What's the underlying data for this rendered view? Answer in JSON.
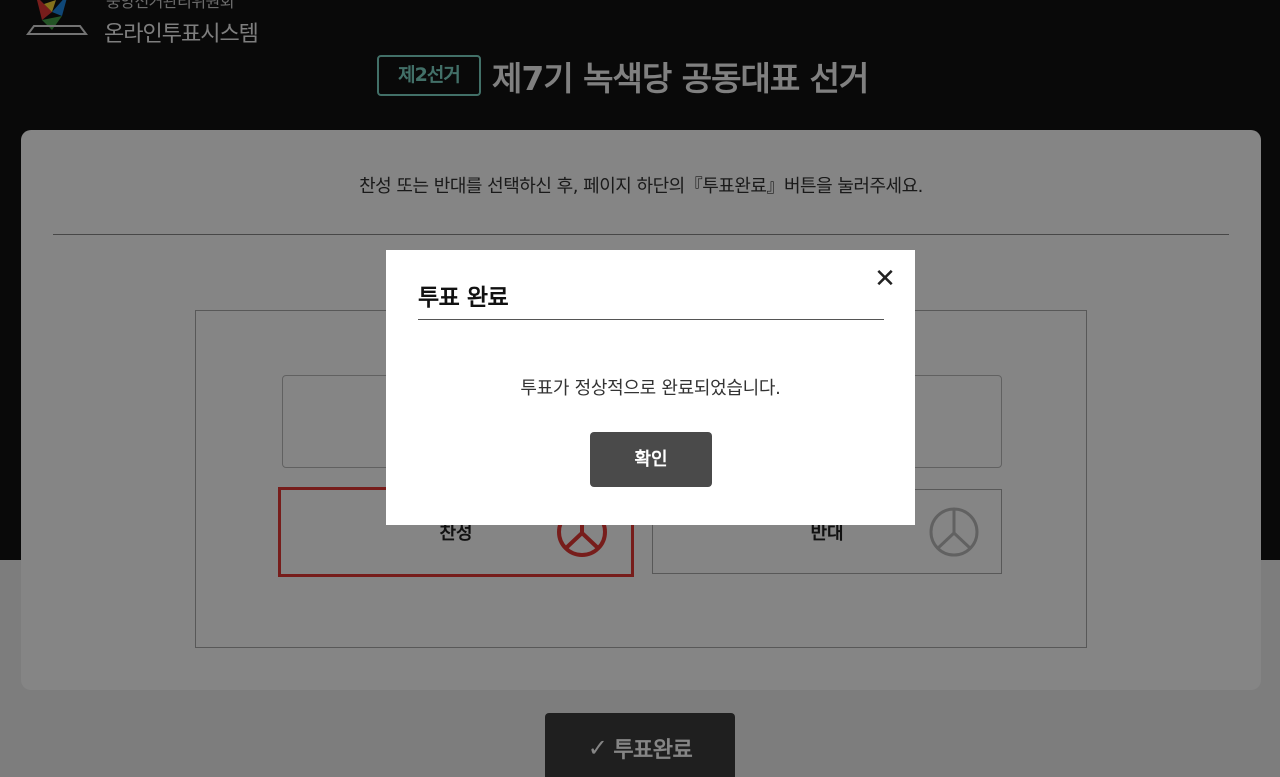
{
  "header": {
    "org_top": "중앙선거관리위원회",
    "org_name": "온라인투표시스템",
    "election_badge": "제2선거",
    "election_title": "제7기 녹색당 공동대표 선거"
  },
  "ballot": {
    "instruction": "찬성 또는 반대를 선택하신 후, 페이지 하단의『투표완료』버튼을 눌러주세요.",
    "options": [
      {
        "label": "찬성",
        "selected": true
      },
      {
        "label": "반대",
        "selected": false
      }
    ],
    "submit_label": "투표완료",
    "submit_icon": "checkmark-icon"
  },
  "modal": {
    "title": "투표 완료",
    "message": "투표가 정상적으로 완료되었습니다.",
    "confirm_label": "확인",
    "close_icon": "close-icon"
  },
  "colors": {
    "accent_badge": "#7fd6c8",
    "selected_border": "#e53935",
    "header_bg": "#121212"
  }
}
